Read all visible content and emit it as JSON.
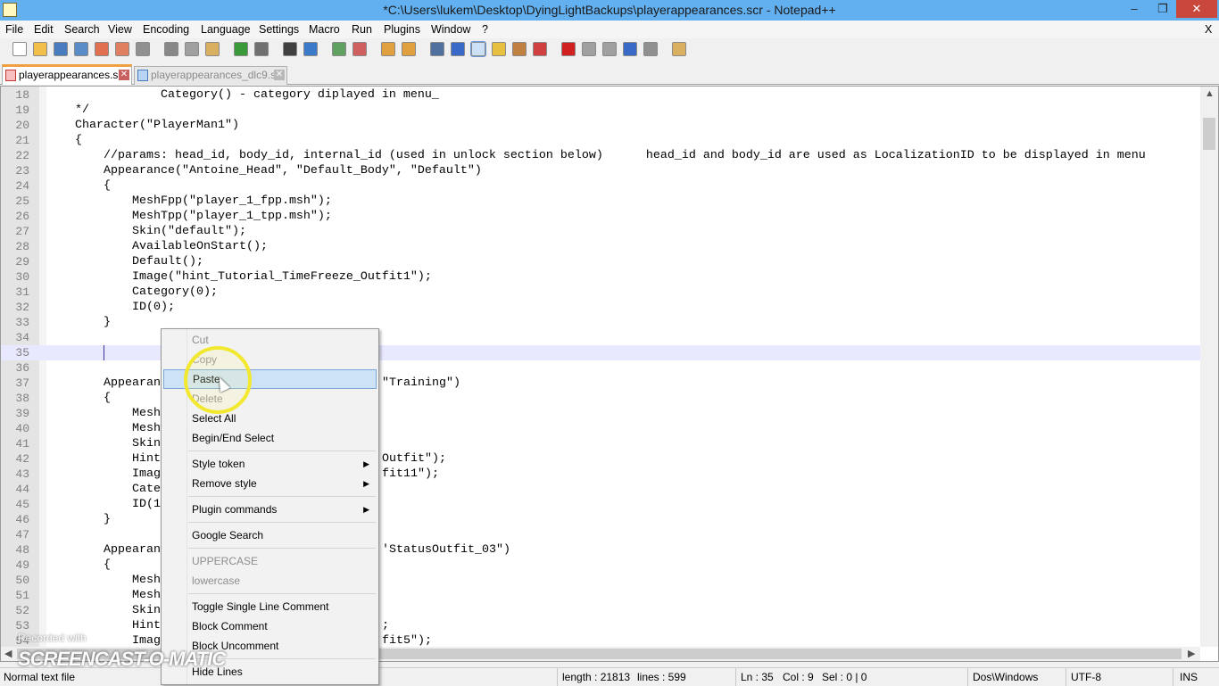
{
  "window": {
    "title": "*C:\\Users\\lukem\\Desktop\\DyingLightBackups\\playerappearances.scr - Notepad++",
    "minimize": "‒",
    "restore": "❐",
    "close": "✕",
    "doc_close": "X"
  },
  "menubar": [
    "File",
    "Edit",
    "Search",
    "View",
    "Encoding",
    "Language",
    "Settings",
    "Macro",
    "Run",
    "Plugins",
    "Window",
    "?"
  ],
  "toolbar": [
    {
      "icon": "new-file-icon",
      "color": "#ffffff"
    },
    {
      "icon": "open-file-icon",
      "color": "#f2c04a"
    },
    {
      "icon": "save-icon",
      "color": "#4a7cc0"
    },
    {
      "icon": "save-all-icon",
      "color": "#5a8cc8"
    },
    {
      "icon": "close-icon",
      "color": "#e07050"
    },
    {
      "icon": "close-all-icon",
      "color": "#e08060"
    },
    {
      "icon": "print-icon",
      "color": "#909090"
    },
    {
      "icon": "cut-icon",
      "color": "#888888"
    },
    {
      "icon": "copy-icon",
      "color": "#a0a0a0"
    },
    {
      "icon": "paste-icon",
      "color": "#d8b060"
    },
    {
      "icon": "undo-icon",
      "color": "#3a9a3a"
    },
    {
      "icon": "redo-icon",
      "color": "#707070"
    },
    {
      "icon": "find-icon",
      "color": "#404040"
    },
    {
      "icon": "replace-icon",
      "color": "#3a7ac8"
    },
    {
      "icon": "zoom-in-icon",
      "color": "#60a060"
    },
    {
      "icon": "zoom-out-icon",
      "color": "#d06060"
    },
    {
      "icon": "sync-vertical-icon",
      "color": "#e0a040"
    },
    {
      "icon": "sync-horizontal-icon",
      "color": "#e0a040"
    },
    {
      "icon": "word-wrap-icon",
      "color": "#5070a0"
    },
    {
      "icon": "show-all-chars-icon",
      "color": "#3a6ac8"
    },
    {
      "icon": "indent-guide-icon",
      "color": "#3a6ac8",
      "active": true
    },
    {
      "icon": "udl-icon",
      "color": "#e8c040"
    },
    {
      "icon": "doc-map-icon",
      "color": "#c08040"
    },
    {
      "icon": "function-list-icon",
      "color": "#d04040"
    },
    {
      "icon": "record-macro-icon",
      "color": "#d02020"
    },
    {
      "icon": "stop-macro-icon",
      "color": "#a0a0a0"
    },
    {
      "icon": "play-macro-icon",
      "color": "#a0a0a0"
    },
    {
      "icon": "run-macro-multiple-icon",
      "color": "#3a6ac8"
    },
    {
      "icon": "save-macro-icon",
      "color": "#909090"
    },
    {
      "icon": "launch-in-browser-icon",
      "color": "#d8b060"
    }
  ],
  "tabs": [
    {
      "label": "playerappearances.scr",
      "active": true
    },
    {
      "label": "playerappearances_dlc9.scr",
      "active": false
    }
  ],
  "editor": {
    "current_line": 35,
    "lines": [
      {
        "n": "18",
        "t": "                Category() - category diplayed in menu_"
      },
      {
        "n": "19",
        "t": "    */"
      },
      {
        "n": "20",
        "t": "    Character(\"PlayerMan1\")"
      },
      {
        "n": "21",
        "t": "    {"
      },
      {
        "n": "22",
        "t": "        //params: head_id, body_id, internal_id (used in unlock section below)      head_id and body_id are used as LocalizationID to be displayed in menu"
      },
      {
        "n": "23",
        "t": "        Appearance(\"Antoine_Head\", \"Default_Body\", \"Default\")"
      },
      {
        "n": "24",
        "t": "        {"
      },
      {
        "n": "25",
        "t": "            MeshFpp(\"player_1_fpp.msh\");"
      },
      {
        "n": "26",
        "t": "            MeshTpp(\"player_1_tpp.msh\");"
      },
      {
        "n": "27",
        "t": "            Skin(\"default\");"
      },
      {
        "n": "28",
        "t": "            AvailableOnStart();"
      },
      {
        "n": "29",
        "t": "            Default();"
      },
      {
        "n": "30",
        "t": "            Image(\"hint_Tutorial_TimeFreeze_Outfit1\");"
      },
      {
        "n": "31",
        "t": "            Category(0);"
      },
      {
        "n": "32",
        "t": "            ID(0);"
      },
      {
        "n": "33",
        "t": "        }"
      },
      {
        "n": "34",
        "t": ""
      },
      {
        "n": "35",
        "t": ""
      },
      {
        "n": "36",
        "t": ""
      },
      {
        "n": "37",
        "t": "        Appearan",
        "r": "\"Training\")"
      },
      {
        "n": "38",
        "t": "        {"
      },
      {
        "n": "39",
        "t": "            Mesh"
      },
      {
        "n": "40",
        "t": "            Mesh"
      },
      {
        "n": "41",
        "t": "            Skin"
      },
      {
        "n": "42",
        "t": "            Hint",
        "r": "Outfit\");"
      },
      {
        "n": "43",
        "t": "            Imag",
        "r": "fit11\");"
      },
      {
        "n": "44",
        "t": "            Cate"
      },
      {
        "n": "45",
        "t": "            ID(1"
      },
      {
        "n": "46",
        "t": "        }"
      },
      {
        "n": "47",
        "t": ""
      },
      {
        "n": "48",
        "t": "        Appearan",
        "r": "'StatusOutfit_03\")"
      },
      {
        "n": "49",
        "t": "        {"
      },
      {
        "n": "50",
        "t": "            Mesh"
      },
      {
        "n": "51",
        "t": "            Mesh"
      },
      {
        "n": "52",
        "t": "            Skin"
      },
      {
        "n": "53",
        "t": "            Hint",
        "r": ";"
      },
      {
        "n": "54",
        "t": "            Imag",
        "r": "fit5\");"
      }
    ]
  },
  "context_menu": [
    {
      "label": "Cut",
      "disabled": true
    },
    {
      "label": "Copy",
      "disabled": true
    },
    {
      "label": "Paste",
      "highlighted": true
    },
    {
      "label": "Delete",
      "disabled": true
    },
    {
      "label": "Select All"
    },
    {
      "label": "Begin/End Select"
    },
    {
      "separator": true
    },
    {
      "label": "Style token",
      "submenu": true
    },
    {
      "label": "Remove style",
      "submenu": true
    },
    {
      "separator": true
    },
    {
      "label": "Plugin commands",
      "submenu": true
    },
    {
      "separator": true
    },
    {
      "label": "Google Search"
    },
    {
      "separator": true
    },
    {
      "label": "UPPERCASE",
      "disabled": true
    },
    {
      "label": "lowercase",
      "disabled": true
    },
    {
      "separator": true
    },
    {
      "label": "Toggle Single Line Comment"
    },
    {
      "label": "Block Comment"
    },
    {
      "label": "Block Uncomment"
    },
    {
      "separator": true
    },
    {
      "label": "Hide Lines"
    }
  ],
  "statusbar": {
    "file_type": "Normal text file",
    "length": "length : 21813",
    "lines": "lines : 599",
    "ln": "Ln : 35",
    "col": "Col : 9",
    "sel": "Sel : 0 | 0",
    "eol": "Dos\\Windows",
    "encoding": "UTF-8",
    "mode": "INS"
  },
  "watermark": {
    "line1": "Recorded with",
    "line2": "SCREENCAST-O-MATIC"
  }
}
